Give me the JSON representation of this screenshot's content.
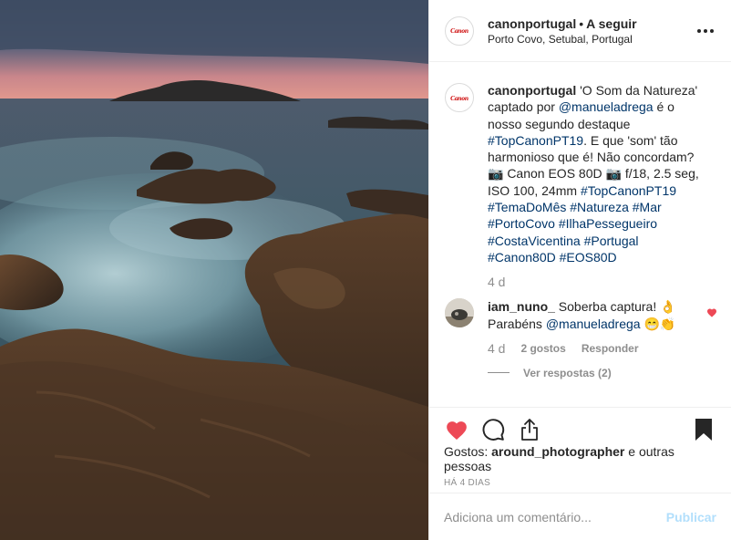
{
  "post": {
    "username": "canonportugal",
    "separator": "•",
    "follow_label": "A seguir",
    "location": "Porto Covo, Setubal, Portugal",
    "avatar_logo_text": "Canon"
  },
  "caption": {
    "username": "canonportugal",
    "text_1": " 'O Som da Natureza' captado por ",
    "mention": "@manueladrega",
    "text_2": " é o nosso segundo destaque ",
    "tag_toppt": "#TopCanonPT19",
    "text_3": ". E que 'som' tão harmonioso que é! Não concordam? 📷 Canon EOS 80D 📷 f/18, 2.5 seg, ISO 100, 24mm ",
    "hashtags": [
      "#TopCanonPT19",
      "#TemaDoMês",
      "#Natureza",
      "#Mar",
      "#PortoCovo",
      "#IlhaPessegueiro",
      "#CostaVicentina",
      "#Portugal",
      "#Canon80D",
      "#EOS80D"
    ],
    "time": "4 d"
  },
  "comment": {
    "username": "iam_nuno_",
    "text_1": " Soberba captura! 👌 Parabéns ",
    "mention": "@manueladrega",
    "text_2": " 😁👏",
    "time": "4 d",
    "likes": "2 gostos",
    "reply_label": "Responder",
    "view_replies": "Ver respostas (2)"
  },
  "actions": {
    "likes_prefix": "Gostos: ",
    "liked_by": "around_photographer",
    "likes_suffix": " e outras pessoas",
    "posted_ago": "HÁ 4 DIAS"
  },
  "add_comment": {
    "placeholder": "Adiciona um comentário...",
    "publish_label": "Publicar"
  },
  "colors": {
    "like_red": "#ed4956",
    "link_blue": "#003569",
    "brand_red": "#cc0000"
  }
}
